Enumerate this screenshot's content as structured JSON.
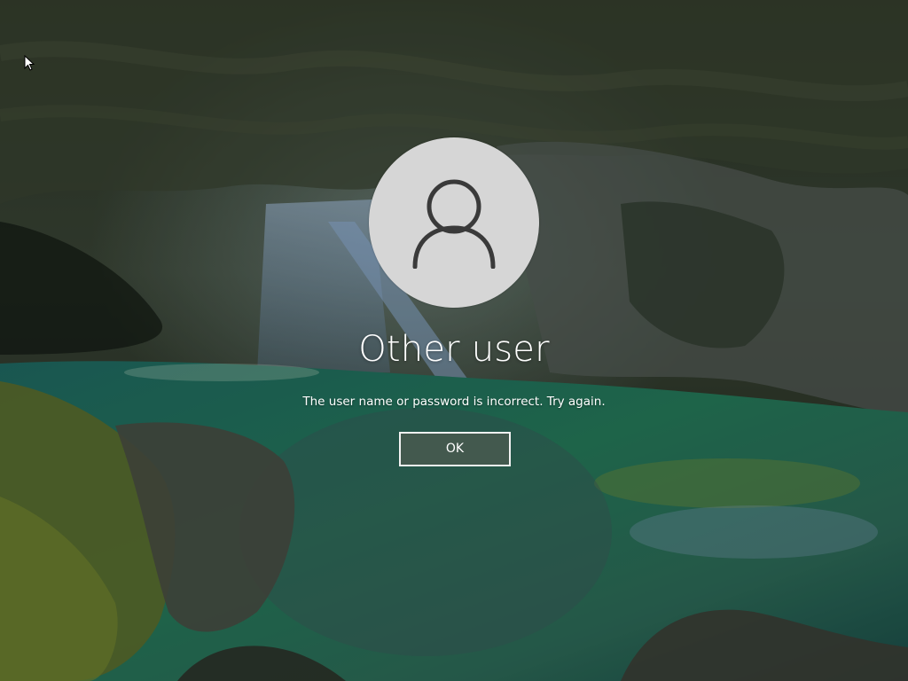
{
  "login": {
    "user_name": "Other user",
    "error_message": "The user name or password is incorrect. Try again.",
    "ok_label": "OK",
    "avatar_icon": "user-silhouette-icon",
    "cursor_icon": "mouse-pointer-icon"
  },
  "colors": {
    "avatar_background": "#d6d6d6",
    "avatar_glyph": "#3a3a3a",
    "text": "#ffffff",
    "button_border": "#f2f2f2"
  }
}
